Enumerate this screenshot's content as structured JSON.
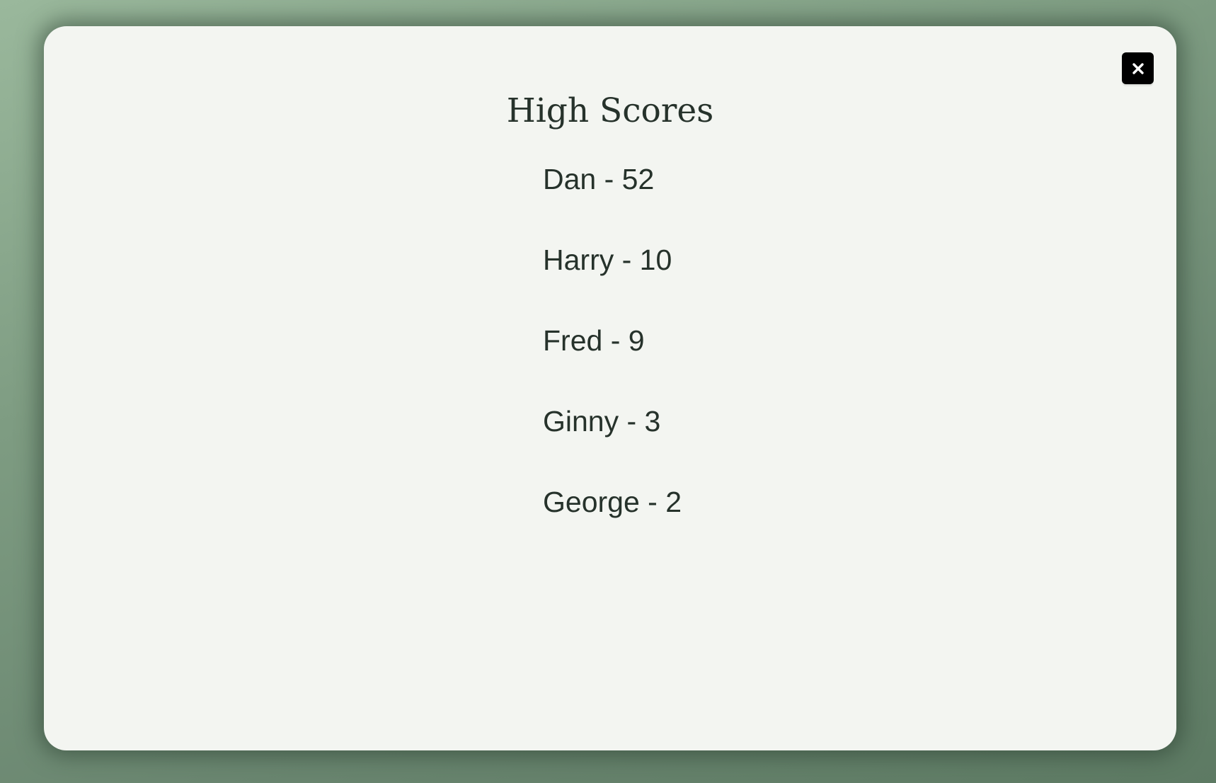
{
  "modal": {
    "title": "High Scores",
    "close_icon": "close-icon"
  },
  "scores": [
    {
      "text": "Dan - 52"
    },
    {
      "text": "Harry - 10"
    },
    {
      "text": "Fred - 9"
    },
    {
      "text": "Ginny - 3"
    },
    {
      "text": "George - 2"
    }
  ],
  "colors": {
    "background_top": "#9ab89c",
    "background_bottom": "#5d7a63",
    "modal_bg": "#f3f5f1",
    "text": "#26322b",
    "close_button_bg": "#000000"
  }
}
